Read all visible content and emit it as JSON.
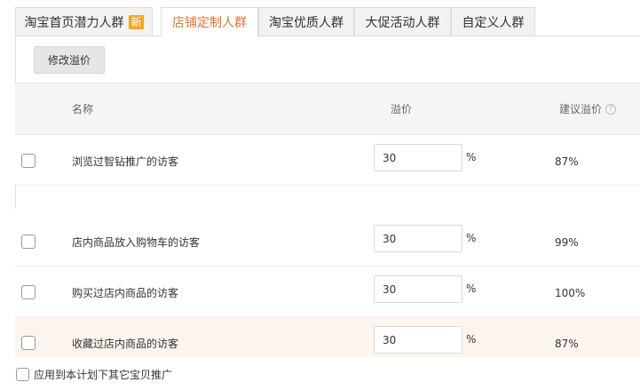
{
  "tabs": [
    {
      "label": "淘宝首页潜力人群",
      "badge": "新"
    },
    {
      "label": "店铺定制人群"
    },
    {
      "label": "淘宝优质人群"
    },
    {
      "label": "大促活动人群"
    },
    {
      "label": "自定义人群"
    }
  ],
  "toolbar": {
    "modify_label": "修改溢价"
  },
  "table": {
    "headers": {
      "name": "名称",
      "premium": "溢价",
      "suggested": "建议溢价"
    },
    "help_icon": "?",
    "rows": [
      {
        "name": "浏览过智钻推广的访客",
        "premium": "30",
        "unit": "%",
        "suggested": "87%"
      },
      {
        "name": "店内商品放入购物车的访客",
        "premium": "30",
        "unit": "%",
        "suggested": "99%"
      },
      {
        "name": "购买过店内商品的访客",
        "premium": "30",
        "unit": "%",
        "suggested": "100%"
      },
      {
        "name": "收藏过店内商品的访客",
        "premium": "30",
        "unit": "%",
        "suggested": "87%"
      }
    ]
  },
  "footer": {
    "apply_label": "应用到本计划下其它宝贝推广"
  },
  "colors": {
    "active_tab": "#e4762f",
    "badge": "#f5a623",
    "highlight_row": "#fcf5ee"
  }
}
